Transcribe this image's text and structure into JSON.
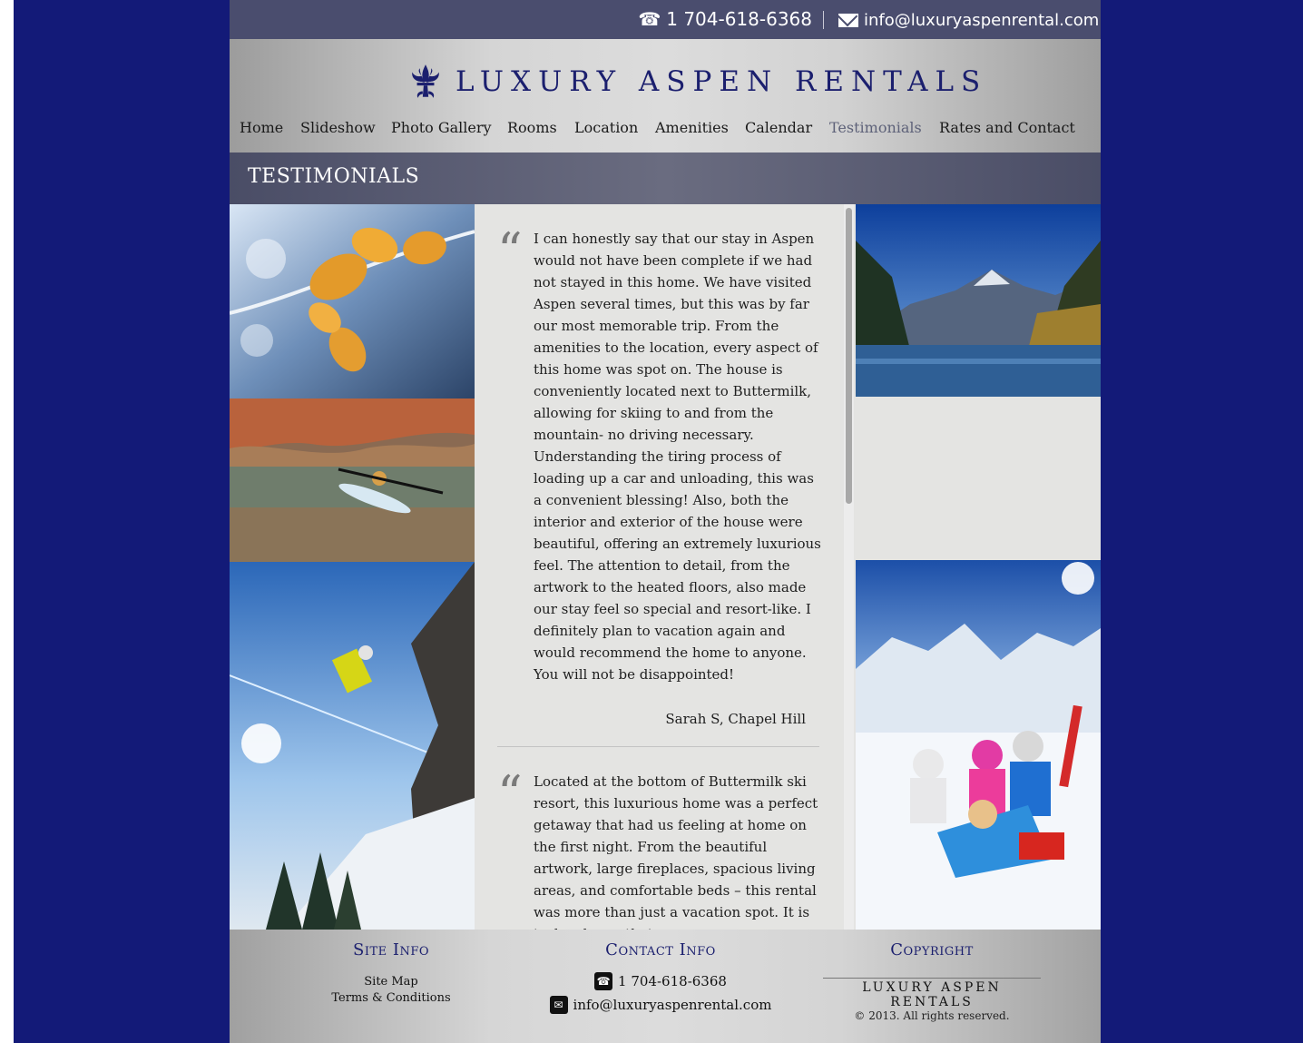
{
  "topbar": {
    "phone": "1 704-618-6368",
    "email": "info@luxuryaspenrental.com"
  },
  "brand": {
    "name": "LUXURY ASPEN RENTALS",
    "icon": "fleur-de-lis-icon",
    "color": "#1b1f6e"
  },
  "nav": {
    "items": [
      "Home",
      "Slideshow",
      "Photo Gallery",
      "Rooms",
      "Location",
      "Amenities",
      "Calendar",
      "Testimonials",
      "Rates and Contact"
    ],
    "active": "Testimonials"
  },
  "page": {
    "title": "TESTIMONIALS"
  },
  "testimonials": [
    {
      "text": "I can honestly say that our stay in Aspen would not have been complete if we had not stayed in this home. We have visited Aspen several times, but this was by far our most memorable trip. From the amenities to the location, every aspect of this home was spot on. The house is conveniently located next to Buttermilk, allowing for skiing to and from the mountain- no driving necessary. Understanding the tiring process of loading up a car and unloading, this was a convenient blessing! Also, both the interior and exterior of the house were beautiful, offering an extremely luxurious feel. The attention to detail, from the artwork to the heated floors, also made our stay feel so special and resort-like. I definitely plan to vacation again and would recommend the home to anyone. You will not be disappointed!",
      "author": "Sarah S, Chapel Hill"
    },
    {
      "text": "Located at the bottom of Buttermilk ski resort, this luxurious home was a perfect getaway that had us feeling at home on the first night. From the beautiful artwork, large fireplaces, spacious living areas, and comfortable beds – this rental was more than just a vacation spot. It is truly a home that",
      "author": ""
    }
  ],
  "footer": {
    "site_info": {
      "heading": "Site Info",
      "links": [
        "Site Map",
        "Terms & Conditions"
      ]
    },
    "contact_info": {
      "heading": "Contact Info",
      "phone": "1 704-618-6368",
      "email": "info@luxuryaspenrental.com"
    },
    "copyright": {
      "heading": "Copyright",
      "brand": "LUXURY ASPEN RENTALS",
      "text": "© 2013. All rights reserved."
    }
  },
  "colors": {
    "page_background": "#131a78",
    "topbar": "#4a4d6e",
    "active_nav": "#5e6279"
  }
}
